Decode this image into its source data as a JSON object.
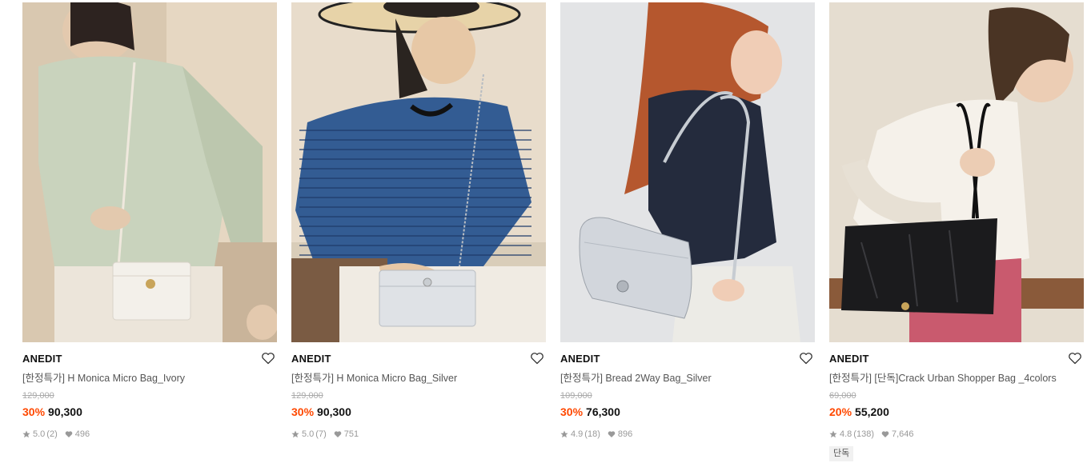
{
  "products": [
    {
      "brand": "ANEDIT",
      "name": "[한정특가] H Monica Micro Bag_Ivory",
      "original_price": "129,000",
      "discount": "30%",
      "price": "90,300",
      "rating": "5.0",
      "reviews": "(2)",
      "likes": "496",
      "badge": null
    },
    {
      "brand": "ANEDIT",
      "name": "[한정특가] H Monica Micro Bag_Silver",
      "original_price": "129,000",
      "discount": "30%",
      "price": "90,300",
      "rating": "5.0",
      "reviews": "(7)",
      "likes": "751",
      "badge": null
    },
    {
      "brand": "ANEDIT",
      "name": "[한정특가] Bread 2Way Bag_Silver",
      "original_price": "109,000",
      "discount": "30%",
      "price": "76,300",
      "rating": "4.9",
      "reviews": "(18)",
      "likes": "896",
      "badge": null
    },
    {
      "brand": "ANEDIT",
      "name": "[한정특가] [단독]Crack Urban Shopper Bag _4colors",
      "original_price": "69,000",
      "discount": "20%",
      "price": "55,200",
      "rating": "4.8",
      "reviews": "(138)",
      "likes": "7,646",
      "badge": "단독"
    }
  ],
  "colors": {
    "discount": "#ff4800",
    "muted": "#999999",
    "badge_bg": "#f1f1f1"
  },
  "icons": {
    "wishlist": "heart-outline-icon",
    "rating": "star-icon",
    "likes": "heart-filled-icon"
  }
}
